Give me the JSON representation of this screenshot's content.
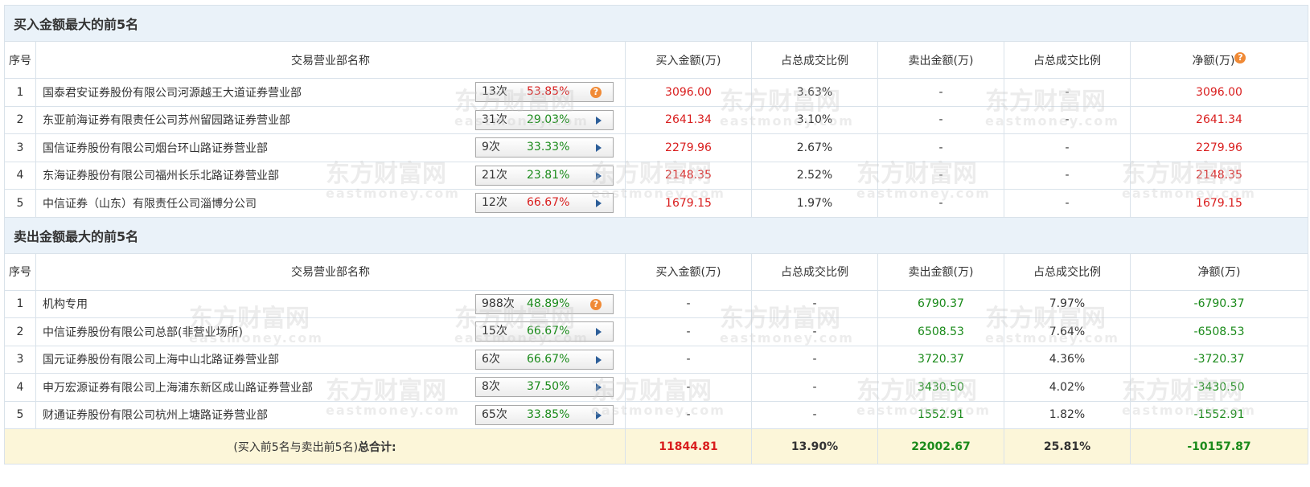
{
  "buy_section": {
    "title": "买入金额最大的前5名",
    "headers": {
      "seq": "序号",
      "name": "交易营业部名称",
      "buy": "买入金额(万)",
      "buy_pct": "占总成交比例",
      "sell": "卖出金额(万)",
      "sell_pct": "占总成交比例",
      "net": "净额(万)"
    },
    "rows": [
      {
        "seq": "1",
        "name": "国泰君安证券股份有限公司河源越王大道证券营业部",
        "count": "13次",
        "rate": "53.85%",
        "rate_color": "red",
        "icon": "question-icon",
        "buy": "3096.00",
        "buy_pct": "3.63%",
        "sell": "-",
        "sell_pct": "-",
        "net": "3096.00"
      },
      {
        "seq": "2",
        "name": "东亚前海证券有限责任公司苏州留园路证券营业部",
        "count": "31次",
        "rate": "29.03%",
        "rate_color": "green",
        "icon": "arrow-right-icon",
        "buy": "2641.34",
        "buy_pct": "3.10%",
        "sell": "-",
        "sell_pct": "-",
        "net": "2641.34"
      },
      {
        "seq": "3",
        "name": "国信证券股份有限公司烟台环山路证券营业部",
        "count": "9次",
        "rate": "33.33%",
        "rate_color": "green",
        "icon": "arrow-right-icon",
        "buy": "2279.96",
        "buy_pct": "2.67%",
        "sell": "-",
        "sell_pct": "-",
        "net": "2279.96"
      },
      {
        "seq": "4",
        "name": "东海证券股份有限公司福州长乐北路证券营业部",
        "count": "21次",
        "rate": "23.81%",
        "rate_color": "green",
        "icon": "arrow-right-icon",
        "buy": "2148.35",
        "buy_pct": "2.52%",
        "sell": "-",
        "sell_pct": "-",
        "net": "2148.35"
      },
      {
        "seq": "5",
        "name": "中信证券（山东）有限责任公司淄博分公司",
        "count": "12次",
        "rate": "66.67%",
        "rate_color": "red",
        "icon": "arrow-right-icon",
        "buy": "1679.15",
        "buy_pct": "1.97%",
        "sell": "-",
        "sell_pct": "-",
        "net": "1679.15"
      }
    ]
  },
  "sell_section": {
    "title": "卖出金额最大的前5名",
    "headers": {
      "seq": "序号",
      "name": "交易营业部名称",
      "buy": "买入金额(万)",
      "buy_pct": "占总成交比例",
      "sell": "卖出金额(万)",
      "sell_pct": "占总成交比例",
      "net": "净额(万)"
    },
    "rows": [
      {
        "seq": "1",
        "name": "机构专用",
        "count": "988次",
        "rate": "48.89%",
        "rate_color": "green",
        "icon": "question-icon",
        "buy": "-",
        "buy_pct": "-",
        "sell": "6790.37",
        "sell_pct": "7.97%",
        "net": "-6790.37"
      },
      {
        "seq": "2",
        "name": "中信证券股份有限公司总部(非营业场所)",
        "count": "15次",
        "rate": "66.67%",
        "rate_color": "green",
        "icon": "arrow-right-icon",
        "buy": "-",
        "buy_pct": "-",
        "sell": "6508.53",
        "sell_pct": "7.64%",
        "net": "-6508.53"
      },
      {
        "seq": "3",
        "name": "国元证券股份有限公司上海中山北路证券营业部",
        "count": "6次",
        "rate": "66.67%",
        "rate_color": "green",
        "icon": "arrow-right-icon",
        "buy": "-",
        "buy_pct": "-",
        "sell": "3720.37",
        "sell_pct": "4.36%",
        "net": "-3720.37"
      },
      {
        "seq": "4",
        "name": "申万宏源证券有限公司上海浦东新区成山路证券营业部",
        "count": "8次",
        "rate": "37.50%",
        "rate_color": "green",
        "icon": "arrow-right-icon",
        "buy": "-",
        "buy_pct": "-",
        "sell": "3430.50",
        "sell_pct": "4.02%",
        "net": "-3430.50"
      },
      {
        "seq": "5",
        "name": "财通证券股份有限公司杭州上塘路证券营业部",
        "count": "65次",
        "rate": "33.85%",
        "rate_color": "green",
        "icon": "arrow-right-icon",
        "buy": "-",
        "buy_pct": "-",
        "sell": "1552.91",
        "sell_pct": "1.82%",
        "net": "-1552.91"
      }
    ]
  },
  "total": {
    "label_prefix": "(买入前5名与卖出前5名)",
    "label_bold": "总合计:",
    "buy": "11844.81",
    "buy_pct": "13.90%",
    "sell": "22002.67",
    "sell_pct": "25.81%",
    "net": "-10157.87"
  },
  "watermark": {
    "cn": "东方财富网",
    "en": "eastmoney.com"
  },
  "colors": {
    "red": "#d91e1e",
    "green": "#1a8a1a",
    "title_bg": "#eaf2f9",
    "total_bg": "#fcf6d9",
    "help_icon": "#f08a36"
  }
}
